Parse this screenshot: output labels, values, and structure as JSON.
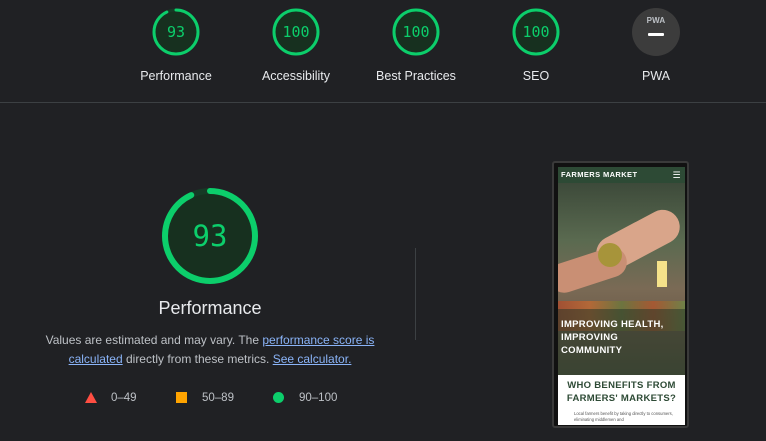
{
  "top_gauges": [
    {
      "score": "93",
      "label": "Performance",
      "fraction": 0.93,
      "color": "#0cce6b"
    },
    {
      "score": "100",
      "label": "Accessibility",
      "fraction": 1.0,
      "color": "#0cce6b"
    },
    {
      "score": "100",
      "label": "Best Practices",
      "fraction": 1.0,
      "color": "#0cce6b"
    },
    {
      "score": "100",
      "label": "SEO",
      "fraction": 1.0,
      "color": "#0cce6b"
    }
  ],
  "pwa": {
    "badge_text": "PWA",
    "label": "PWA"
  },
  "main_gauge": {
    "score": "93",
    "fraction": 0.93,
    "title": "Performance"
  },
  "description": {
    "prefix": "Values are estimated and may vary. The ",
    "link1": "performance score is calculated",
    "middle": " directly from these metrics. ",
    "link2": "See calculator."
  },
  "legend": [
    {
      "range": "0–49",
      "color": "#ff4e42",
      "shape": "triangle"
    },
    {
      "range": "50–89",
      "color": "#ffa400",
      "shape": "square"
    },
    {
      "range": "90–100",
      "color": "#0cce6b",
      "shape": "circle"
    }
  ],
  "screenshot": {
    "brand": "FARMERS MARKET",
    "menu_glyph": "☰",
    "headline": "IMPROVING HEALTH, IMPROVING COMMUNITY",
    "section_title": "WHO BENEFITS FROM FARMERS' MARKETS?",
    "section_body": "Local farmers benefit by taking directly to consumers, eliminating middlemen and"
  },
  "colors": {
    "background": "#202124",
    "pass": "#0cce6b",
    "link": "#8ab4f8"
  }
}
